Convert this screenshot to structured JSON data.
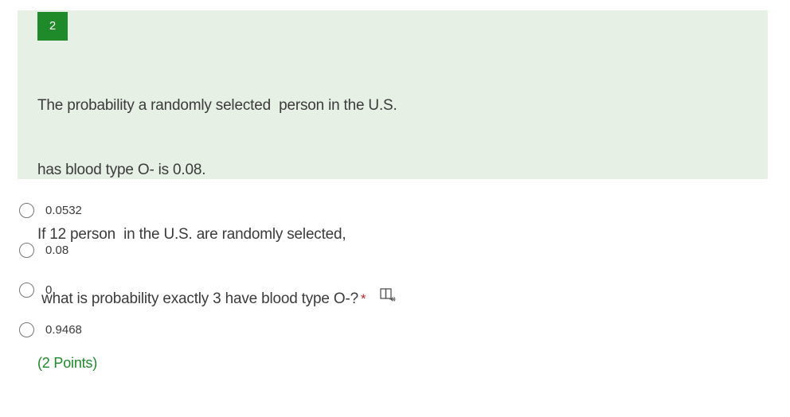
{
  "question": {
    "number": "2",
    "lines": [
      "The probability a randomly selected  person in the U.S.",
      "has blood type O- is 0.08.",
      "If 12 person  in the U.S. are randomly selected,",
      " what is probability exactly 3 have blood type O-?"
    ],
    "required_marker": "*",
    "points": "(2 Points)",
    "icons": {
      "reader": "immersive-reader-icon"
    }
  },
  "options": [
    {
      "label": "0.0532"
    },
    {
      "label": "0.08"
    },
    {
      "label": "0"
    },
    {
      "label": "0.9468"
    }
  ],
  "colors": {
    "card_background": "#e6f0e4",
    "accent_green": "#1e8a2a",
    "required_red": "#c4262e",
    "text": "#3b3b3b"
  }
}
